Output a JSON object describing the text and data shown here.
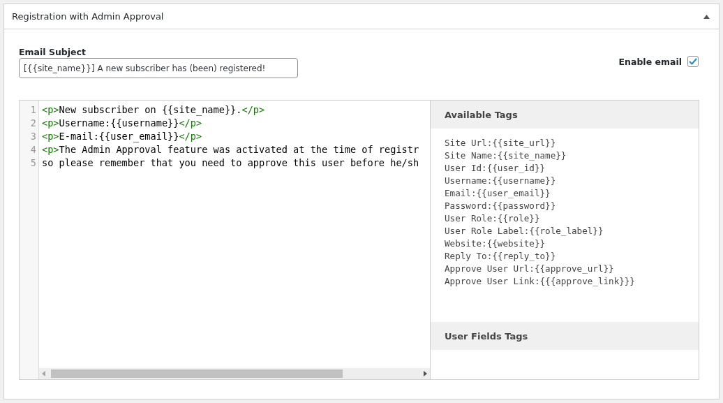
{
  "panel": {
    "title": "Registration with Admin Approval",
    "expanded": true
  },
  "email_subject": {
    "label": "Email Subject",
    "value": "[{{site_name}}] A new subscriber has (been) registered!"
  },
  "enable_email": {
    "label": "Enable email",
    "checked": true
  },
  "editor": {
    "lines": [
      {
        "number": "1",
        "segments": [
          {
            "kind": "tag",
            "text": "<p>"
          },
          {
            "kind": "text",
            "text": "New subscriber on {{site_name}}."
          },
          {
            "kind": "tag",
            "text": "</p>"
          }
        ]
      },
      {
        "number": "2",
        "segments": [
          {
            "kind": "tag",
            "text": "<p>"
          },
          {
            "kind": "text",
            "text": "Username:{{username}}"
          },
          {
            "kind": "tag",
            "text": "</p>"
          }
        ]
      },
      {
        "number": "3",
        "segments": [
          {
            "kind": "tag",
            "text": "<p>"
          },
          {
            "kind": "text",
            "text": "E-mail:{{user_email}}"
          },
          {
            "kind": "tag",
            "text": "</p>"
          }
        ]
      },
      {
        "number": "4",
        "segments": [
          {
            "kind": "tag",
            "text": "<p>"
          },
          {
            "kind": "text",
            "text": "The Admin Approval feature was activated at the time of registr"
          }
        ]
      },
      {
        "number": "5",
        "segments": [
          {
            "kind": "text",
            "text": "so please remember that you need to approve this user before he/sh"
          }
        ]
      }
    ]
  },
  "available_tags": {
    "title": "Available Tags",
    "tags": [
      "Site Url:{{site_url}}",
      "Site Name:{{site_name}}",
      "User Id:{{user_id}}",
      "Username:{{username}}",
      "Email:{{user_email}}",
      "Password:{{password}}",
      "User Role:{{role}}",
      "User Role Label:{{role_label}}",
      "Website:{{website}}",
      "Reply To:{{reply_to}}",
      "Approve User Url:{{approve_url}}",
      "Approve User Link:{{{approve_link}}}"
    ]
  },
  "user_fields_tags": {
    "title": "User Fields Tags"
  }
}
